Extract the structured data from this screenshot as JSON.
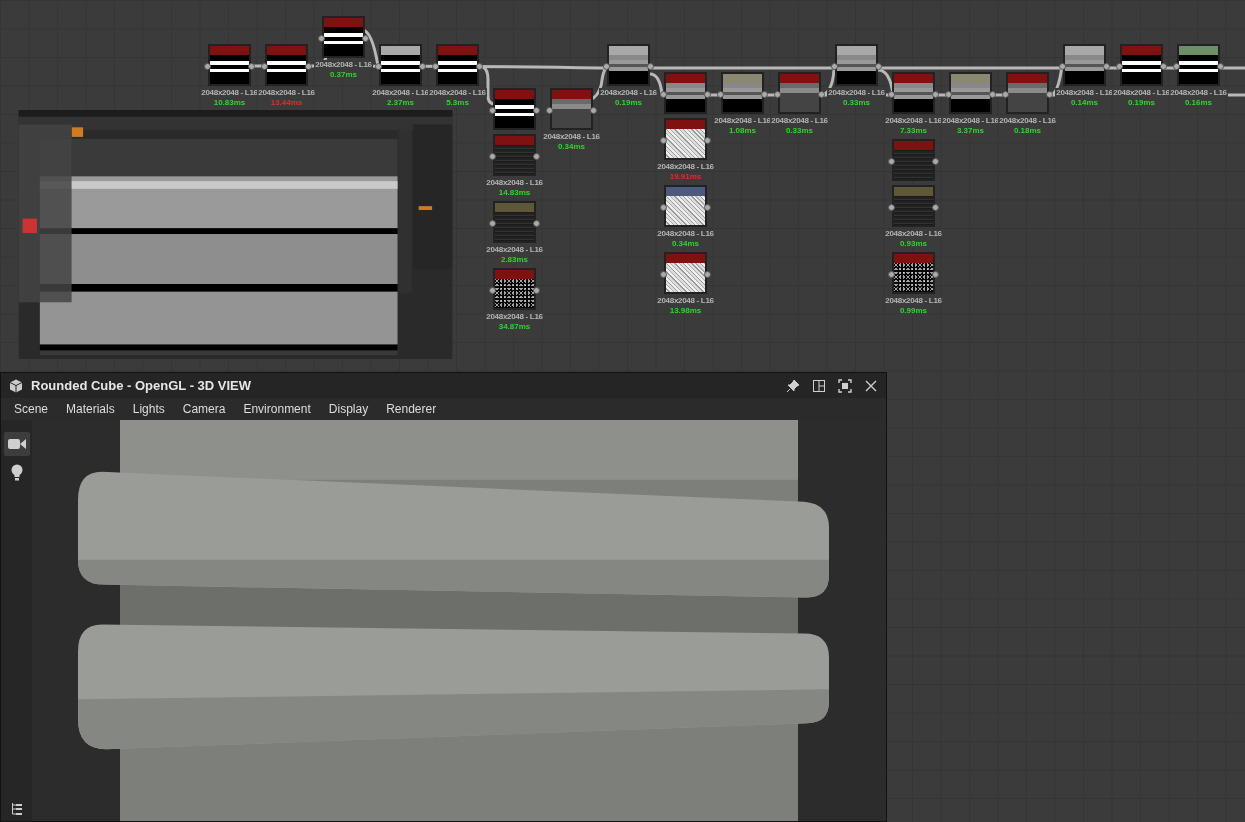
{
  "graph": {
    "columns": [
      {
        "kind": "upper",
        "nodes": [
          {
            "color": "#7f1111",
            "kind": "stripes",
            "resolution": "2048x2048 - L16",
            "time": "10.83ms",
            "slow": false
          }
        ]
      },
      {
        "kind": "upper",
        "nodes": [
          {
            "color": "#7f1111",
            "kind": "stripes",
            "resolution": "2048x2048 - L16",
            "time": "13.44ms",
            "slow": true
          }
        ]
      },
      {
        "kind": "raised",
        "nodes": [
          {
            "color": "#7f1111",
            "kind": "stripes",
            "resolution": "2048x2048 - L16",
            "time": "0.37ms",
            "slow": false
          }
        ]
      },
      {
        "kind": "upper",
        "nodes": [
          {
            "color": "#a8a8a8",
            "kind": "stripes",
            "resolution": "2048x2048 - L16",
            "time": "2.37ms",
            "slow": false
          }
        ]
      },
      {
        "kind": "upper",
        "nodes": [
          {
            "color": "#7f1111",
            "kind": "stripes",
            "resolution": "2048x2048 - L16",
            "time": "5.3ms",
            "slow": false
          }
        ]
      },
      {
        "kind": "bottom",
        "nodes": [
          {
            "color": "#7f1111",
            "kind": "stripes"
          },
          {
            "color": "#7f1111",
            "kind": "noise",
            "resolution": "2048x2048 - L16",
            "time": "14.83ms",
            "slow": false
          },
          {
            "color": "#5e5838",
            "kind": "noise",
            "resolution": "2048x2048 - L16",
            "time": "2.83ms",
            "slow": false
          },
          {
            "color": "#7f1111",
            "kind": "speckle",
            "resolution": "2048x2048 - L16",
            "time": "34.87ms",
            "slow": false
          }
        ]
      },
      {
        "kind": "bottom",
        "nodes": [
          {
            "color": "#7f1111",
            "kind": "gray",
            "resolution": "2048x2048 - L16",
            "time": "0.34ms",
            "slow": false
          }
        ]
      },
      {
        "kind": "upper",
        "nodes": [
          {
            "color": "#a8a8a8",
            "kind": "grille",
            "resolution": "2048x2048 - L16",
            "time": "0.19ms",
            "slow": false
          }
        ]
      },
      {
        "kind": "middle",
        "nodes": [
          {
            "color": "#7f1111",
            "kind": "grille"
          },
          {
            "color": "#7f1111",
            "kind": "marble",
            "resolution": "2048x2048 - L16",
            "time": "19.91ms",
            "slow": true
          },
          {
            "color": "#4c5a80",
            "kind": "marble",
            "resolution": "2048x2048 - L16",
            "time": "0.34ms",
            "slow": false
          },
          {
            "color": "#7f1111",
            "kind": "marble",
            "resolution": "2048x2048 - L16",
            "time": "13.98ms",
            "slow": false
          }
        ]
      },
      {
        "kind": "middle",
        "nodes": [
          {
            "color": "#8a8870",
            "kind": "grille",
            "resolution": "2048x2048 - L16",
            "time": "1.08ms",
            "slow": false
          }
        ]
      },
      {
        "kind": "middle",
        "nodes": [
          {
            "color": "#7f1111",
            "kind": "gray",
            "resolution": "2048x2048 - L16",
            "time": "0.33ms",
            "slow": false
          }
        ]
      },
      {
        "kind": "upper",
        "nodes": [
          {
            "color": "#a8a8a8",
            "kind": "grille",
            "resolution": "2048x2048 - L16",
            "time": "0.33ms",
            "slow": false
          }
        ]
      },
      {
        "kind": "middle",
        "nodes": [
          {
            "color": "#7f1111",
            "kind": "grille",
            "resolution": "2048x2048 - L16",
            "time": "7.33ms",
            "slow": false
          },
          {
            "color": "#7f1111",
            "kind": "noise"
          },
          {
            "color": "#5e5838",
            "kind": "noise",
            "resolution": "2048x2048 - L16",
            "time": "0.93ms",
            "slow": false
          },
          {
            "color": "#7f1111",
            "kind": "speckle",
            "resolution": "2048x2048 - L16",
            "time": "0.99ms",
            "slow": false
          }
        ]
      },
      {
        "kind": "middle",
        "nodes": [
          {
            "color": "#8a8870",
            "kind": "grille",
            "resolution": "2048x2048 - L16",
            "time": "3.37ms",
            "slow": false
          }
        ]
      },
      {
        "kind": "middle",
        "nodes": [
          {
            "color": "#7f1111",
            "kind": "gray",
            "resolution": "2048x2048 - L16",
            "time": "0.18ms",
            "slow": false
          }
        ]
      },
      {
        "kind": "upper",
        "nodes": [
          {
            "color": "#a8a8a8",
            "kind": "grille",
            "resolution": "2048x2048 - L16",
            "time": "0.14ms",
            "slow": false
          }
        ]
      },
      {
        "kind": "upper",
        "nodes": [
          {
            "color": "#7f1111",
            "kind": "stripes",
            "resolution": "2048x2048 - L16",
            "time": "0.19ms",
            "slow": false
          }
        ]
      },
      {
        "kind": "upper",
        "nodes": [
          {
            "color": "#6e8e68",
            "kind": "stripes",
            "resolution": "2048x2048 - L16",
            "time": "0.16ms",
            "slow": false
          }
        ]
      }
    ]
  },
  "view": {
    "title": "Rounded Cube - OpenGL - 3D VIEW",
    "actions": [
      {
        "kind": "pin"
      },
      {
        "kind": "split"
      },
      {
        "kind": "maximize"
      },
      {
        "kind": "close"
      }
    ],
    "menu": [
      "Scene",
      "Materials",
      "Lights",
      "Camera",
      "Environment",
      "Display",
      "Renderer"
    ],
    "tools": [
      {
        "kind": "camera",
        "selected": true
      },
      {
        "kind": "bulb",
        "selected": false
      }
    ],
    "bottom_tools": [
      {
        "kind": "tree"
      }
    ]
  }
}
